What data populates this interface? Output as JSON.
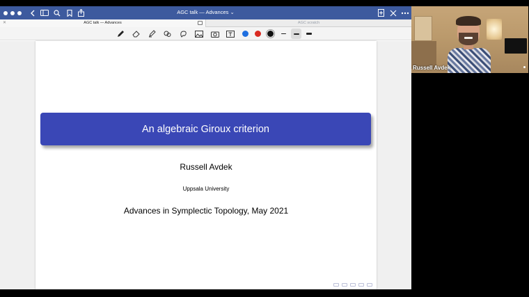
{
  "window": {
    "title": "AGC talk — Advances ⌄"
  },
  "tabs": [
    {
      "label": "AGC talk — Advances",
      "active": true
    },
    {
      "label": "AGC scratch",
      "active": false
    }
  ],
  "titlebar_icons": [
    "back-icon",
    "sidebar-icon",
    "search-icon",
    "bookmark-icon",
    "share-icon",
    "new-page-icon",
    "tools-icon",
    "more-icon"
  ],
  "toolbar": {
    "tools": [
      "pen-icon",
      "eraser-icon",
      "highlighter-icon",
      "lasso-icon",
      "shapes-icon",
      "image-icon",
      "camera-icon",
      "text-icon"
    ],
    "colors": [
      "#1f6fe0",
      "#d92b22",
      "#111111"
    ],
    "stroke_widths": [
      "thin",
      "medium",
      "thick"
    ]
  },
  "slide": {
    "title": "An algebraic Giroux criterion",
    "author": "Russell Avdek",
    "institution": "Uppsala University",
    "event": "Advances in Symplectic Topology, May 2021"
  },
  "video": {
    "participant_name": "Russell Avdek"
  }
}
